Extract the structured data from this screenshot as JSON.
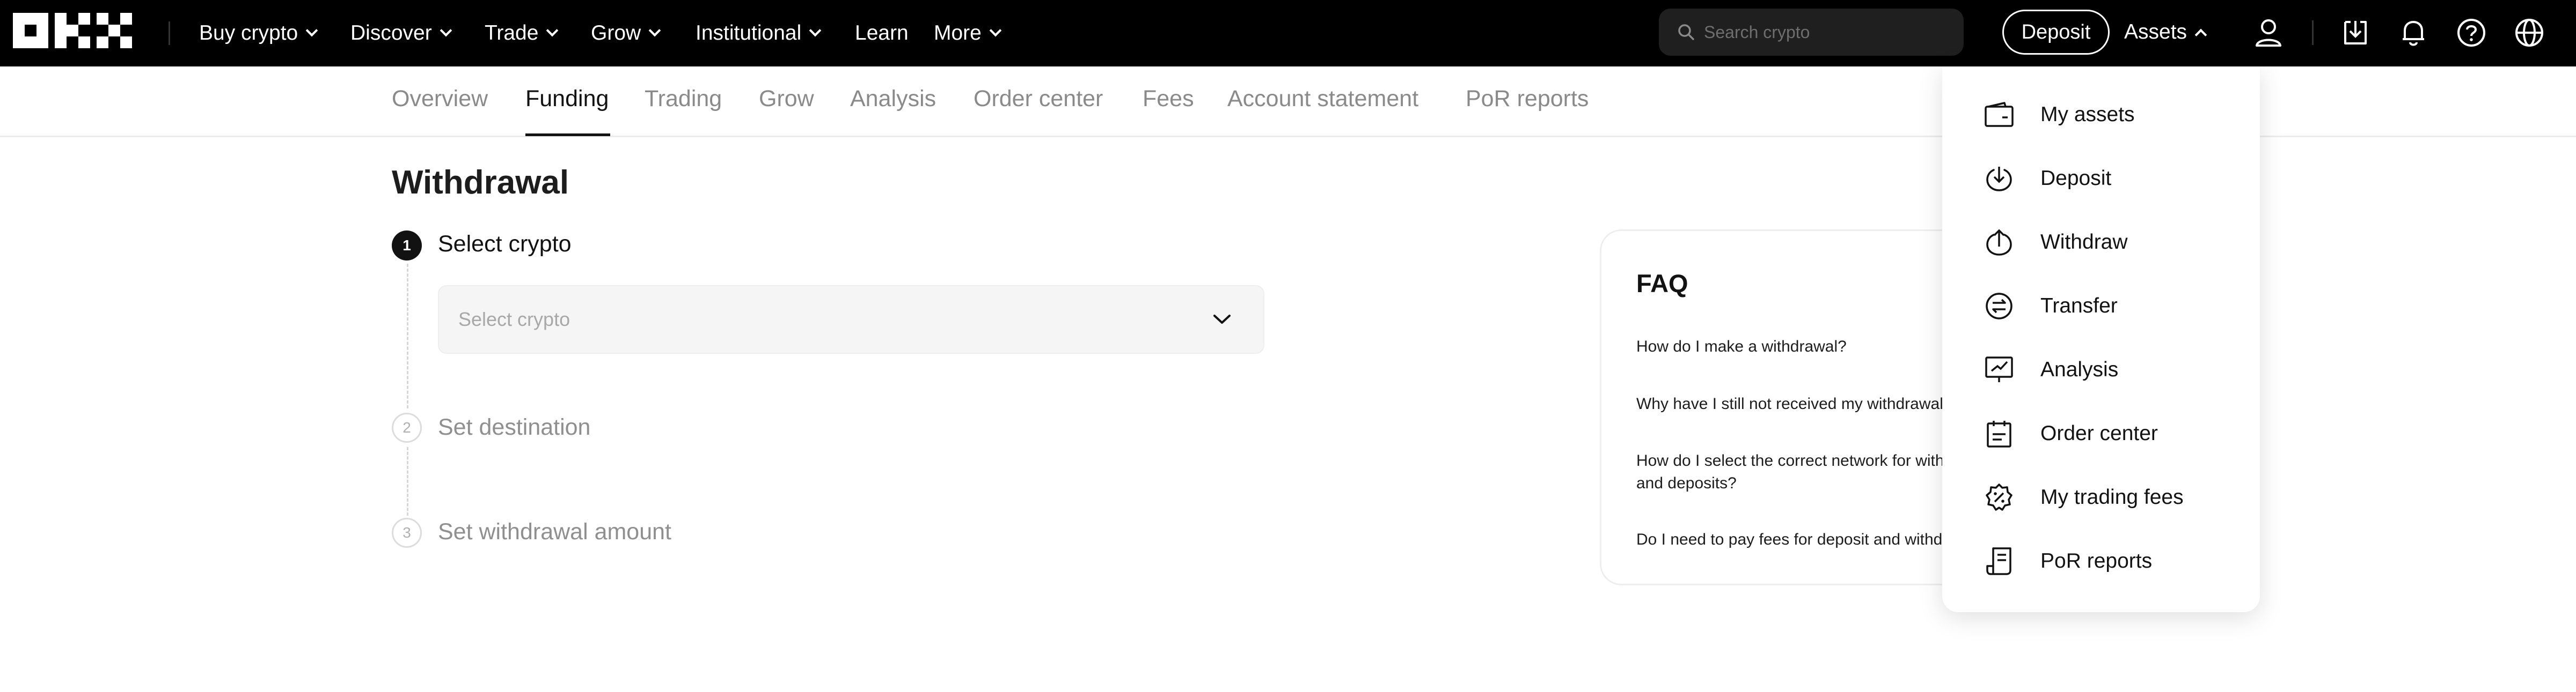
{
  "brand": {
    "logo_name": "OKX"
  },
  "top_nav": {
    "items": [
      {
        "label": "Buy crypto",
        "has_chevron": true
      },
      {
        "label": "Discover",
        "has_chevron": true
      },
      {
        "label": "Trade",
        "has_chevron": true
      },
      {
        "label": "Grow",
        "has_chevron": true
      },
      {
        "label": "Institutional",
        "has_chevron": true
      },
      {
        "label": "Learn",
        "has_chevron": false
      },
      {
        "label": "More",
        "has_chevron": true
      }
    ],
    "search_placeholder": "Search crypto",
    "deposit_label": "Deposit",
    "assets_label": "Assets",
    "right_icons": [
      "user-icon",
      "download-icon",
      "bell-icon",
      "help-icon",
      "globe-icon"
    ]
  },
  "sub_nav": {
    "tabs": [
      "Overview",
      "Funding",
      "Trading",
      "Grow",
      "Analysis",
      "Order center",
      "Fees",
      "Account statement",
      "PoR reports"
    ],
    "active_tab": "Funding"
  },
  "withdrawal": {
    "title": "Withdrawal",
    "steps": [
      {
        "number": "1",
        "label": "Select crypto",
        "active": true
      },
      {
        "number": "2",
        "label": "Set destination",
        "active": false
      },
      {
        "number": "3",
        "label": "Set withdrawal amount",
        "active": false
      }
    ],
    "select_placeholder": "Select crypto"
  },
  "faq": {
    "title": "FAQ",
    "questions": [
      "How do I make a withdrawal?",
      "Why have I still not received my withdrawal?",
      "How do I select the correct network for withdrawals\nand deposits?",
      "Do I need to pay fees for deposit and withdrawal?"
    ]
  },
  "assets_menu": {
    "items": [
      {
        "label": "My assets",
        "icon": "wallet-icon"
      },
      {
        "label": "Deposit",
        "icon": "deposit-icon"
      },
      {
        "label": "Withdraw",
        "icon": "withdraw-icon"
      },
      {
        "label": "Transfer",
        "icon": "transfer-icon"
      },
      {
        "label": "Analysis",
        "icon": "analysis-icon"
      },
      {
        "label": "Order center",
        "icon": "order-center-icon"
      },
      {
        "label": "My trading fees",
        "icon": "trading-fees-icon"
      },
      {
        "label": "PoR reports",
        "icon": "por-reports-icon"
      }
    ]
  },
  "colors": {
    "topbar_bg": "#000000",
    "text_primary": "#121212",
    "text_muted": "#8a8a8a",
    "input_bg": "#f5f5f5"
  }
}
